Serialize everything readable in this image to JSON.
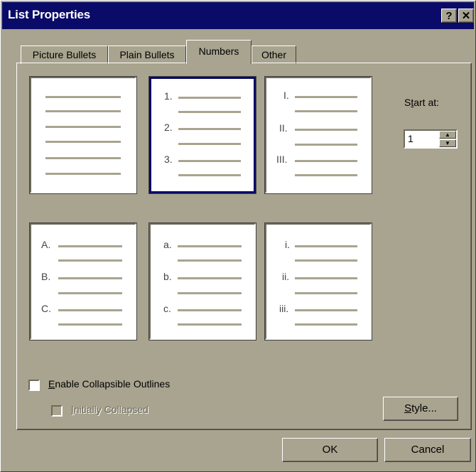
{
  "window": {
    "title": "List Properties",
    "help_glyph": "?",
    "close_glyph": "✕"
  },
  "tabs": [
    {
      "label": "Picture Bullets",
      "active": false
    },
    {
      "label": "Plain Bullets",
      "active": false
    },
    {
      "label": "Numbers",
      "active": true
    },
    {
      "label": "Other",
      "active": false
    }
  ],
  "styles": [
    {
      "markers": [
        "",
        "",
        ""
      ],
      "selected": false
    },
    {
      "markers": [
        "1.",
        "2.",
        "3."
      ],
      "selected": true
    },
    {
      "markers": [
        "I.",
        "II.",
        "III."
      ],
      "selected": false
    },
    {
      "markers": [
        "A.",
        "B.",
        "C."
      ],
      "selected": false
    },
    {
      "markers": [
        "a.",
        "b.",
        "c."
      ],
      "selected": false
    },
    {
      "markers": [
        "i.",
        "ii.",
        "iii."
      ],
      "selected": false
    }
  ],
  "start_at": {
    "label_prefix": "S",
    "label_accel": "t",
    "label_rest": "art at:",
    "value": "1"
  },
  "options": {
    "enable_collapsible": {
      "accel": "E",
      "rest": "nable Collapsible Outlines",
      "checked": false
    },
    "initially_collapsed": {
      "accel": "I",
      "rest": "nitially Collapsed",
      "checked": false,
      "disabled": true
    }
  },
  "buttons": {
    "style_accel": "S",
    "style_rest": "tyle...",
    "ok": "OK",
    "cancel": "Cancel"
  }
}
